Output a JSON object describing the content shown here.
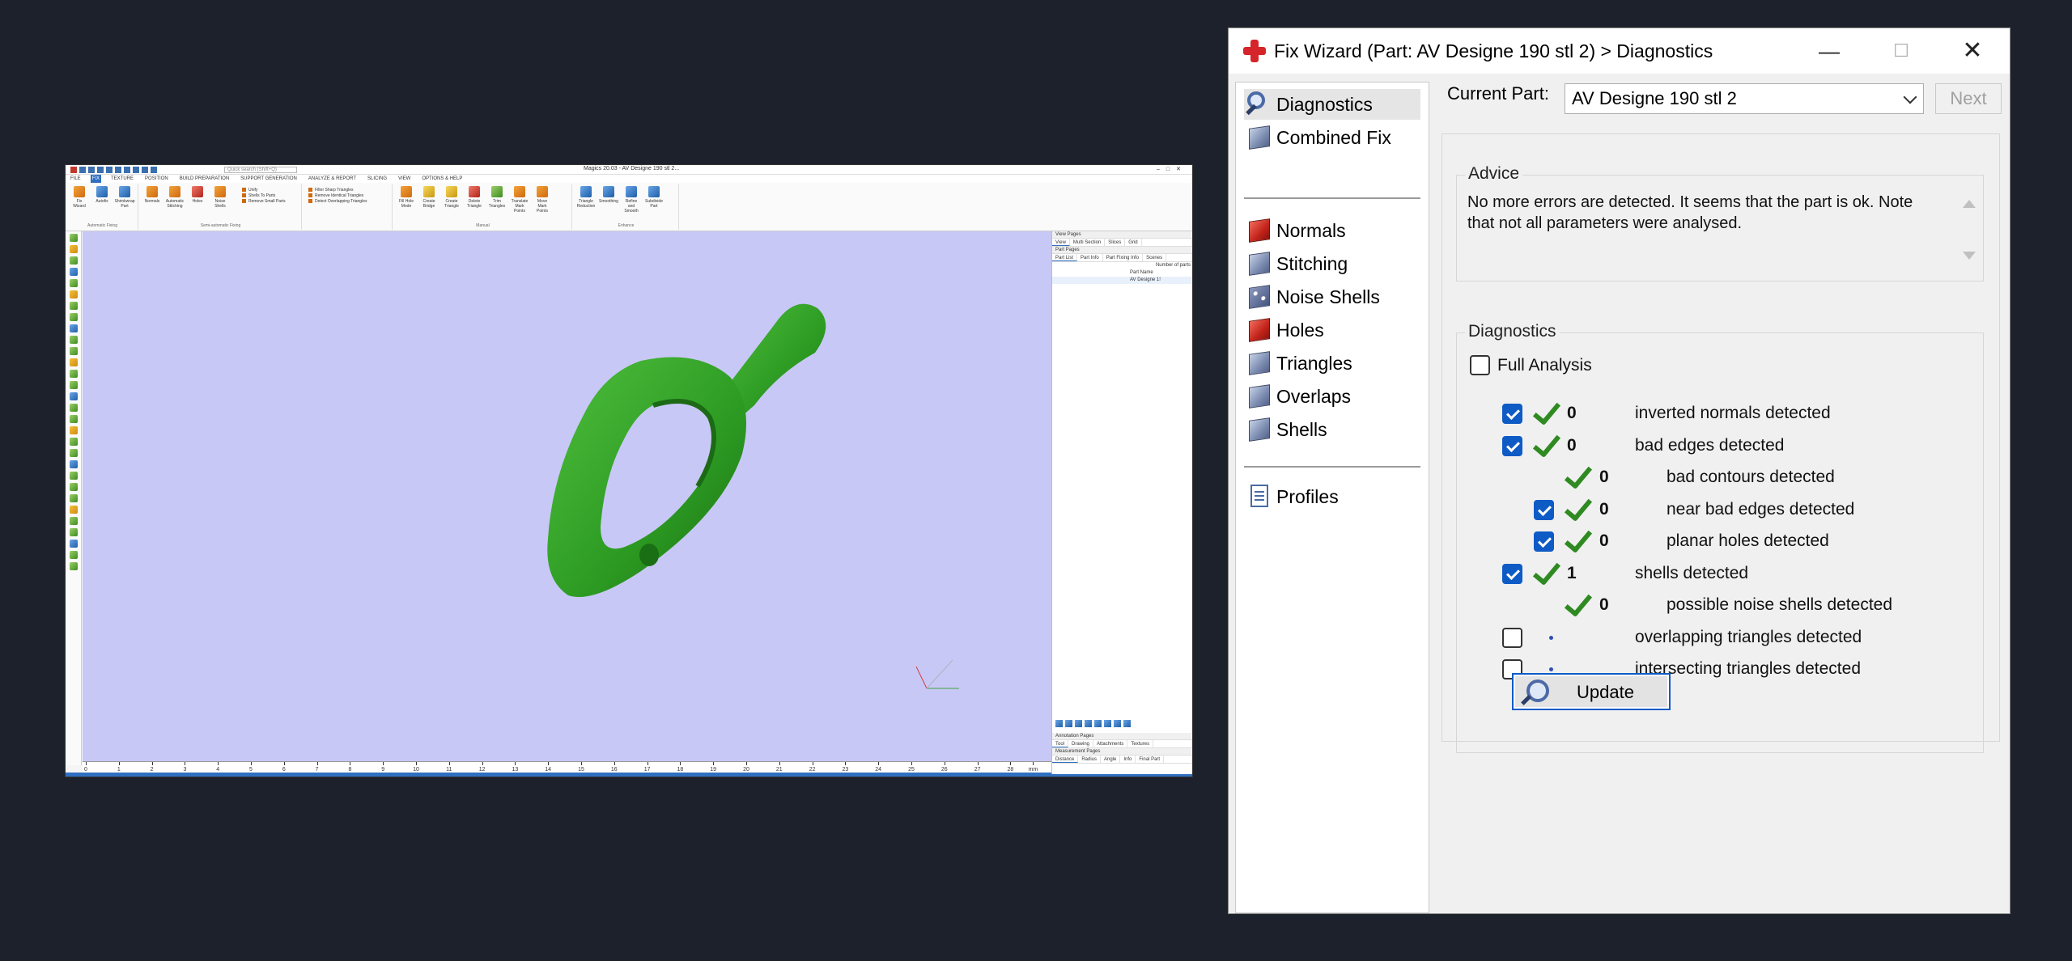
{
  "magics": {
    "window_title": "Magics 20.03 - AV Designe 190 stl 2...",
    "search_placeholder": "Quick search (Shift+Q)",
    "ribbon_tabs": [
      "FILE",
      "FIX",
      "TEXTURE",
      "POSITION",
      "BUILD PREPARATION",
      "SUPPORT GENERATION",
      "ANALYZE & REPORT",
      "SLICING",
      "VIEW",
      "OPTIONS & HELP"
    ],
    "active_tab": "FIX",
    "ribbon_groups": [
      {
        "label": "Automatic Fixing",
        "buttons": [
          "Fix Wizard",
          "Autofix",
          "Shrinkwrap Part"
        ]
      },
      {
        "label": "Semi-automatic Fixing",
        "buttons": [
          "Normals",
          "Automatic Stitching",
          "Holes",
          "Noise Shells"
        ],
        "list": [
          "Unify",
          "Shells To Parts",
          "Remove Small Parts"
        ]
      },
      {
        "label": "",
        "list": [
          "Filter Sharp Triangles",
          "Remove Identical Triangles",
          "Detect Overlapping Triangles"
        ]
      },
      {
        "label": "Manual",
        "buttons": [
          "Fill Hole Mode",
          "Create Bridge",
          "Create Triangle",
          "Delete Triangle",
          "Trim Triangles",
          "Translate Mark Points",
          "Move Mark Points"
        ]
      },
      {
        "label": "Enhance",
        "buttons": [
          "Triangle Reduction",
          "Smoothing",
          "Refine and Smooth",
          "Subdivide Part"
        ]
      }
    ],
    "ruler_labels": [
      "0",
      "1",
      "2",
      "3",
      "4",
      "5",
      "6",
      "7",
      "8",
      "9",
      "10",
      "11",
      "12",
      "13",
      "14",
      "15",
      "16",
      "17",
      "18",
      "19",
      "20",
      "21",
      "22",
      "23",
      "24",
      "25",
      "26",
      "27",
      "28",
      "mm"
    ],
    "right_pane": {
      "view_pages": "View Pages",
      "view_tabs": [
        "View",
        "Multi Section",
        "Slices",
        "Grid"
      ],
      "part_pages": "Part Pages",
      "part_tabs": [
        "Part List",
        "Part Info",
        "Part Fixing Info",
        "Scenes"
      ],
      "number_of_parts": "Number of parts",
      "part_name_header": "Part Name",
      "part_row": "AV Designe 1!",
      "annotation_pages": "Annotation Pages",
      "annotation_tabs": [
        "Tool",
        "Drawing",
        "Attachments",
        "Textures"
      ],
      "measurement_pages": "Measurement Pages",
      "measurement_tabs": [
        "Distance",
        "Radius",
        "Angle",
        "Info",
        "Final Part"
      ]
    }
  },
  "fix_wizard": {
    "title": "Fix Wizard (Part: AV Designe 190 stl 2) > Diagnostics",
    "min_symbol": "—",
    "max_symbol": "☐",
    "close_symbol": "✕",
    "nav": {
      "top": [
        {
          "label": "Diagnostics",
          "icon": "magnifier-icon",
          "active": true
        },
        {
          "label": "Combined Fix",
          "icon": "combined-fix-icon",
          "active": false
        }
      ],
      "middle": [
        {
          "label": "Normals",
          "icon": "normals-icon"
        },
        {
          "label": "Stitching",
          "icon": "stitching-icon"
        },
        {
          "label": "Noise Shells",
          "icon": "noise-shells-icon"
        },
        {
          "label": "Holes",
          "icon": "holes-icon"
        },
        {
          "label": "Triangles",
          "icon": "triangles-icon"
        },
        {
          "label": "Overlaps",
          "icon": "overlaps-icon"
        },
        {
          "label": "Shells",
          "icon": "shells-icon"
        }
      ],
      "bottom": [
        {
          "label": "Profiles",
          "icon": "profiles-icon"
        }
      ]
    },
    "current_part_label": "Current Part:",
    "current_part_value": "AV Designe 190 stl 2",
    "next_label": "Next",
    "advice": {
      "title": "Advice",
      "text": "No more errors are detected. It seems that the part is ok. Note that not all parameters were analysed."
    },
    "diagnostics": {
      "title": "Diagnostics",
      "full_analysis_label": "Full Analysis",
      "full_analysis_checked": false,
      "rows": [
        {
          "label": "inverted normals detected",
          "count": "0",
          "checked": true,
          "status": "ok",
          "indent": 0
        },
        {
          "label": "bad edges detected",
          "count": "0",
          "checked": true,
          "status": "ok",
          "indent": 0
        },
        {
          "label": "bad contours detected",
          "count": "0",
          "checked": null,
          "status": "ok",
          "indent": 1
        },
        {
          "label": "near bad edges detected",
          "count": "0",
          "checked": true,
          "status": "ok",
          "indent": 1
        },
        {
          "label": "planar holes detected",
          "count": "0",
          "checked": true,
          "status": "ok",
          "indent": 1
        },
        {
          "label": "shells detected",
          "count": "1",
          "checked": true,
          "status": "ok",
          "indent": 0
        },
        {
          "label": "possible noise shells detected",
          "count": "0",
          "checked": null,
          "status": "ok",
          "indent": 1
        },
        {
          "label": "overlapping triangles detected",
          "count": "",
          "checked": false,
          "status": "not-analysed",
          "indent": 0
        },
        {
          "label": "intersecting triangles detected",
          "count": "",
          "checked": false,
          "status": "not-analysed",
          "indent": 0
        }
      ]
    },
    "update_label": "Update"
  }
}
